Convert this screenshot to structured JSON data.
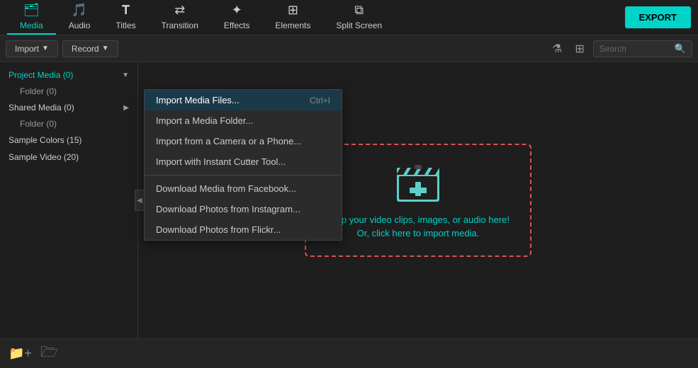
{
  "nav": {
    "items": [
      {
        "id": "media",
        "label": "Media",
        "icon": "🗂",
        "active": true
      },
      {
        "id": "audio",
        "label": "Audio",
        "icon": "♪"
      },
      {
        "id": "titles",
        "label": "Titles",
        "icon": "T"
      },
      {
        "id": "transition",
        "label": "Transition",
        "icon": "⇄"
      },
      {
        "id": "effects",
        "label": "Effects",
        "icon": "✦"
      },
      {
        "id": "elements",
        "label": "Elements",
        "icon": "⊞"
      },
      {
        "id": "splitscreen",
        "label": "Split Screen",
        "icon": "⧉"
      }
    ],
    "export_label": "EXPORT"
  },
  "toolbar": {
    "import_label": "Import",
    "record_label": "Record",
    "search_placeholder": "Search"
  },
  "sidebar": {
    "items": [
      {
        "id": "project-media",
        "label": "Project Media (0)",
        "active": true,
        "expandable": true
      },
      {
        "id": "folder",
        "label": "Folder (0)",
        "indent": true
      },
      {
        "id": "shared-media",
        "label": "Shared Media (0)",
        "expandable": true
      },
      {
        "id": "folder2",
        "label": "Folder (0)",
        "indent": true
      },
      {
        "id": "sample-colors",
        "label": "Sample Colors (15)"
      },
      {
        "id": "sample-video",
        "label": "Sample Video (20)"
      }
    ]
  },
  "dropdown": {
    "items": [
      {
        "id": "import-files",
        "label": "Import Media Files...",
        "shortcut": "Ctrl+I",
        "highlighted": true
      },
      {
        "id": "import-folder",
        "label": "Import a Media Folder...",
        "shortcut": ""
      },
      {
        "id": "import-camera",
        "label": "Import from a Camera or a Phone...",
        "shortcut": ""
      },
      {
        "id": "import-cutter",
        "label": "Import with Instant Cutter Tool...",
        "shortcut": ""
      },
      {
        "id": "divider1",
        "type": "divider"
      },
      {
        "id": "download-facebook",
        "label": "Download Media from Facebook...",
        "shortcut": ""
      },
      {
        "id": "download-instagram",
        "label": "Download Photos from Instagram...",
        "shortcut": ""
      },
      {
        "id": "download-flickr",
        "label": "Download Photos from Flickr...",
        "shortcut": ""
      }
    ]
  },
  "dropzone": {
    "line1": "Drop your video clips, images, or audio here!",
    "line2": "Or, click here to import media."
  },
  "bottom": {
    "add_folder_label": "Add Folder",
    "icons": [
      "folder-add",
      "folder"
    ]
  }
}
